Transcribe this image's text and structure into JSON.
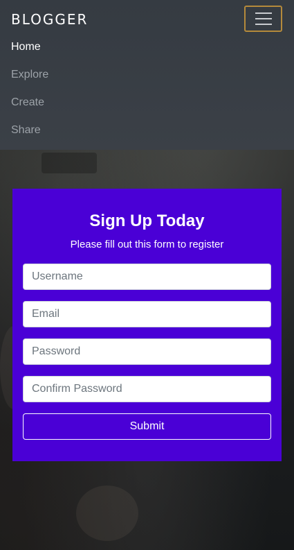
{
  "navbar": {
    "brand": "BLOGGER",
    "toggler_icon": "hamburger-menu-icon",
    "items": [
      {
        "label": "Home",
        "active": true
      },
      {
        "label": "Explore",
        "active": false
      },
      {
        "label": "Create",
        "active": false
      },
      {
        "label": "Share",
        "active": false
      }
    ]
  },
  "form": {
    "title": "Sign Up Today",
    "subtitle": "Please fill out this form to register",
    "username_placeholder": "Username",
    "email_placeholder": "Email",
    "password_placeholder": "Password",
    "confirm_placeholder": "Confirm Password",
    "submit_label": "Submit"
  },
  "colors": {
    "navbar_bg": "#3b4047",
    "card_bg": "#4a00d6",
    "toggler_border": "#b58a3b"
  }
}
